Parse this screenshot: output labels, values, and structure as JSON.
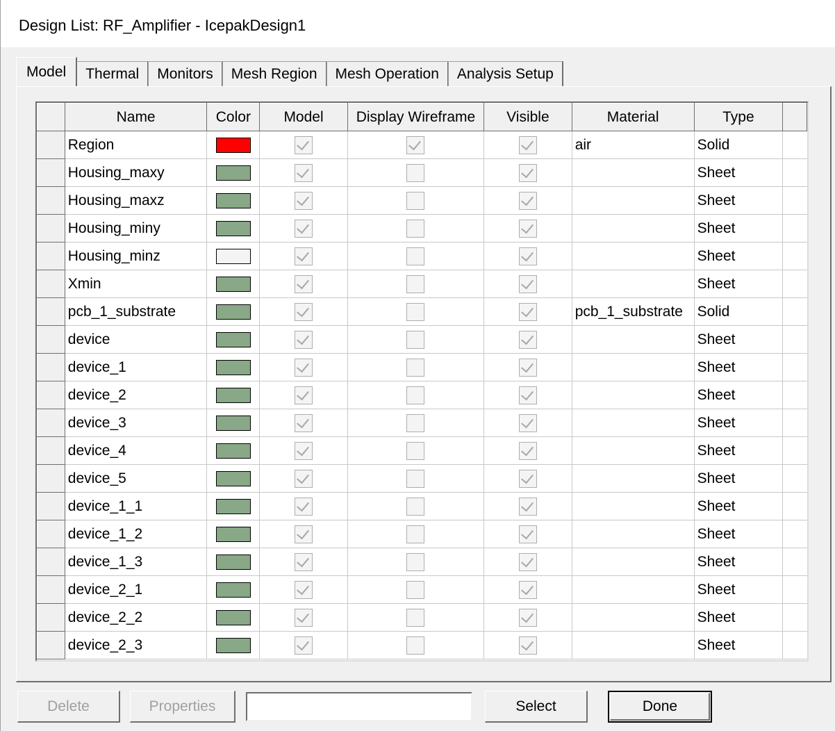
{
  "window": {
    "title": "Design List: RF_Amplifier - IcepakDesign1"
  },
  "tabs": [
    {
      "label": "Model",
      "active": true
    },
    {
      "label": "Thermal",
      "active": false
    },
    {
      "label": "Monitors",
      "active": false
    },
    {
      "label": "Mesh Region",
      "active": false
    },
    {
      "label": "Mesh Operation",
      "active": false
    },
    {
      "label": "Analysis Setup",
      "active": false
    }
  ],
  "table": {
    "columns": [
      "Name",
      "Color",
      "Model",
      "Display Wireframe",
      "Visible",
      "Material",
      "Type"
    ],
    "rows": [
      {
        "name": "Region",
        "color": "#ff0000",
        "model": true,
        "wireframe": true,
        "visible": true,
        "material": "air",
        "type": "Solid"
      },
      {
        "name": "Housing_maxy",
        "color": "#88a888",
        "model": true,
        "wireframe": false,
        "visible": true,
        "material": "",
        "type": "Sheet"
      },
      {
        "name": "Housing_maxz",
        "color": "#88a888",
        "model": true,
        "wireframe": false,
        "visible": true,
        "material": "",
        "type": "Sheet"
      },
      {
        "name": "Housing_miny",
        "color": "#88a888",
        "model": true,
        "wireframe": false,
        "visible": true,
        "material": "",
        "type": "Sheet"
      },
      {
        "name": "Housing_minz",
        "color": "#f4f4f4",
        "model": true,
        "wireframe": false,
        "visible": true,
        "material": "",
        "type": "Sheet"
      },
      {
        "name": "Xmin",
        "color": "#88a888",
        "model": true,
        "wireframe": false,
        "visible": true,
        "material": "",
        "type": "Sheet"
      },
      {
        "name": "pcb_1_substrate",
        "color": "#88a888",
        "model": true,
        "wireframe": false,
        "visible": true,
        "material": "pcb_1_substrate",
        "type": "Solid"
      },
      {
        "name": "device",
        "color": "#88a888",
        "model": true,
        "wireframe": false,
        "visible": true,
        "material": "",
        "type": "Sheet"
      },
      {
        "name": "device_1",
        "color": "#88a888",
        "model": true,
        "wireframe": false,
        "visible": true,
        "material": "",
        "type": "Sheet"
      },
      {
        "name": "device_2",
        "color": "#88a888",
        "model": true,
        "wireframe": false,
        "visible": true,
        "material": "",
        "type": "Sheet"
      },
      {
        "name": "device_3",
        "color": "#88a888",
        "model": true,
        "wireframe": false,
        "visible": true,
        "material": "",
        "type": "Sheet"
      },
      {
        "name": "device_4",
        "color": "#88a888",
        "model": true,
        "wireframe": false,
        "visible": true,
        "material": "",
        "type": "Sheet"
      },
      {
        "name": "device_5",
        "color": "#88a888",
        "model": true,
        "wireframe": false,
        "visible": true,
        "material": "",
        "type": "Sheet"
      },
      {
        "name": "device_1_1",
        "color": "#88a888",
        "model": true,
        "wireframe": false,
        "visible": true,
        "material": "",
        "type": "Sheet"
      },
      {
        "name": "device_1_2",
        "color": "#88a888",
        "model": true,
        "wireframe": false,
        "visible": true,
        "material": "",
        "type": "Sheet"
      },
      {
        "name": "device_1_3",
        "color": "#88a888",
        "model": true,
        "wireframe": false,
        "visible": true,
        "material": "",
        "type": "Sheet"
      },
      {
        "name": "device_2_1",
        "color": "#88a888",
        "model": true,
        "wireframe": false,
        "visible": true,
        "material": "",
        "type": "Sheet"
      },
      {
        "name": "device_2_2",
        "color": "#88a888",
        "model": true,
        "wireframe": false,
        "visible": true,
        "material": "",
        "type": "Sheet"
      },
      {
        "name": "device_2_3",
        "color": "#88a888",
        "model": true,
        "wireframe": false,
        "visible": true,
        "material": "",
        "type": "Sheet"
      }
    ]
  },
  "buttons": {
    "delete_label": "Delete",
    "properties_label": "Properties",
    "select_label": "Select",
    "done_label": "Done"
  },
  "search": {
    "value": ""
  }
}
